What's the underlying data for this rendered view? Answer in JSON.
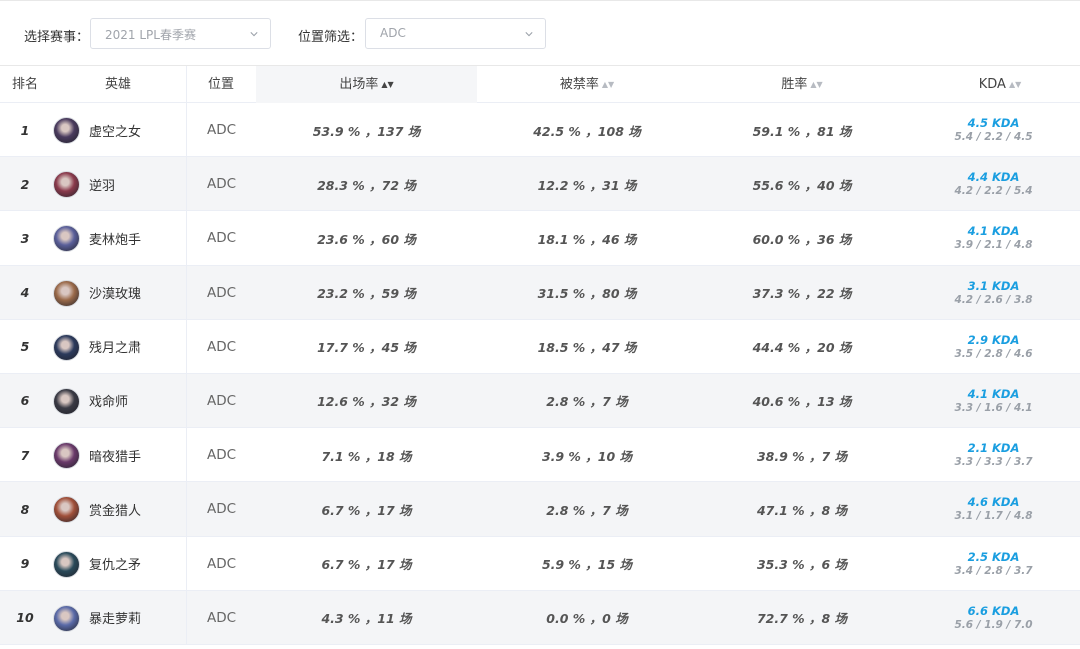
{
  "filters": {
    "event_label": "选择赛事：",
    "event_value": "2021 LPL春季赛",
    "position_label": "位置筛选：",
    "position_value": "ADC"
  },
  "columns": {
    "rank": "排名",
    "hero": "英雄",
    "position": "位置",
    "pick_rate": "出场率",
    "ban_rate": "被禁率",
    "win_rate": "胜率",
    "kda": "KDA"
  },
  "rows": [
    {
      "rank": "1",
      "hero": "虚空之女",
      "position": "ADC",
      "pick": "53.9 % ，137 场",
      "ban": "42.5 % ，108 场",
      "win": "59.1 % ，81 场",
      "kda": "4.5 KDA",
      "kda_detail": "5.4 / 2.2 / 4.5",
      "avatar_color": "#4a3b5e"
    },
    {
      "rank": "2",
      "hero": "逆羽",
      "position": "ADC",
      "pick": "28.3 % ，72 场",
      "ban": "12.2 % ，31 场",
      "win": "55.6 % ，40 场",
      "kda": "4.4 KDA",
      "kda_detail": "4.2 / 2.2 / 5.4",
      "avatar_color": "#8a3a4c"
    },
    {
      "rank": "3",
      "hero": "麦林炮手",
      "position": "ADC",
      "pick": "23.6 % ，60 场",
      "ban": "18.1 % ，46 场",
      "win": "60.0 % ，36 场",
      "kda": "4.1 KDA",
      "kda_detail": "3.9 / 2.1 / 4.8",
      "avatar_color": "#5a5f9a"
    },
    {
      "rank": "4",
      "hero": "沙漠玫瑰",
      "position": "ADC",
      "pick": "23.2 % ，59 场",
      "ban": "31.5 % ，80 场",
      "win": "37.3 % ，22 场",
      "kda": "3.1 KDA",
      "kda_detail": "4.2 / 2.6 / 3.8",
      "avatar_color": "#9a6a4a"
    },
    {
      "rank": "5",
      "hero": "残月之肃",
      "position": "ADC",
      "pick": "17.7 % ，45 场",
      "ban": "18.5 % ，47 场",
      "win": "44.4 % ，20 场",
      "kda": "2.9 KDA",
      "kda_detail": "3.5 / 2.8 / 4.6",
      "avatar_color": "#2c3a5c"
    },
    {
      "rank": "6",
      "hero": "戏命师",
      "position": "ADC",
      "pick": "12.6 % ，32 场",
      "ban": "2.8 % ，7 场",
      "win": "40.6 % ，13 场",
      "kda": "4.1 KDA",
      "kda_detail": "3.3 / 1.6 / 4.1",
      "avatar_color": "#3a3a44"
    },
    {
      "rank": "7",
      "hero": "暗夜猎手",
      "position": "ADC",
      "pick": "7.1 % ，18 场",
      "ban": "3.9 % ，10 场",
      "win": "38.9 % ，7 场",
      "kda": "2.1 KDA",
      "kda_detail": "3.3 / 3.3 / 3.7",
      "avatar_color": "#6a3a6a"
    },
    {
      "rank": "8",
      "hero": "赏金猎人",
      "position": "ADC",
      "pick": "6.7 % ，17 场",
      "ban": "2.8 % ，7 场",
      "win": "47.1 % ，8 场",
      "kda": "4.6 KDA",
      "kda_detail": "3.1 / 1.7 / 4.8",
      "avatar_color": "#a0503a"
    },
    {
      "rank": "9",
      "hero": "复仇之矛",
      "position": "ADC",
      "pick": "6.7 % ，17 场",
      "ban": "5.9 % ，15 场",
      "win": "35.3 % ，6 场",
      "kda": "2.5 KDA",
      "kda_detail": "3.4 / 2.8 / 3.7",
      "avatar_color": "#2a4a5a"
    },
    {
      "rank": "10",
      "hero": "暴走萝莉",
      "position": "ADC",
      "pick": "4.3 % ，11 场",
      "ban": "0.0 % ，0 场",
      "win": "72.7 % ，8 场",
      "kda": "6.6 KDA",
      "kda_detail": "5.6 / 1.9 / 7.0",
      "avatar_color": "#5a6aa8"
    }
  ],
  "colors": {
    "kda_accent": "#1a9ee0",
    "row_alt_bg": "#f4f5f7",
    "sorted_header_bg": "#f5f6f8"
  },
  "sort": {
    "active_column": "pick_rate",
    "direction": "descending"
  }
}
